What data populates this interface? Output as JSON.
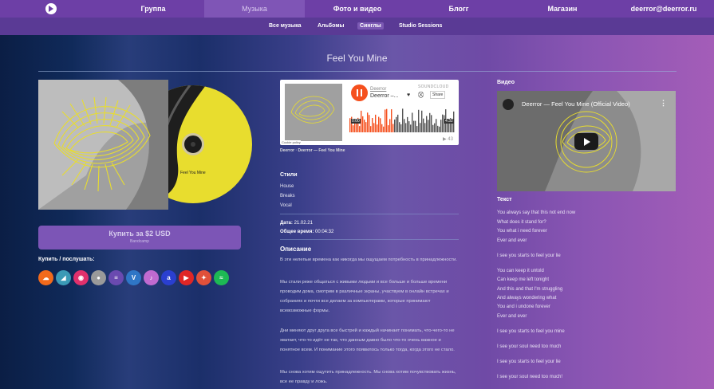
{
  "nav": {
    "items": [
      {
        "label": "Группа"
      },
      {
        "label": "Музыка"
      },
      {
        "label": "Фото и видео"
      },
      {
        "label": "Блогг"
      },
      {
        "label": "Магазин"
      },
      {
        "label": "deerror@deerror.ru"
      }
    ],
    "active": "Музыка"
  },
  "subnav": {
    "items": [
      {
        "label": "Все музыка"
      },
      {
        "label": "Альбомы"
      },
      {
        "label": "Синглы"
      },
      {
        "label": "Studio Sessions"
      }
    ],
    "active": "Синглы"
  },
  "page": {
    "title": "Feel You Mine"
  },
  "cd": {
    "text": "Feel You Mine"
  },
  "buy": {
    "button_label": "Купить за $2 USD",
    "button_sub": "Bandcamp",
    "title": "Купить / послушать:",
    "services": [
      {
        "icon": "soundcloud-icon",
        "color": "#f26a1b"
      },
      {
        "icon": "bandcamp-icon",
        "color": "#3b9ab6"
      },
      {
        "icon": "podcast-icon",
        "color": "#e1306c"
      },
      {
        "icon": "apple-icon",
        "color": "#9a9a9a"
      },
      {
        "icon": "deezer-icon",
        "color": "#6a4ab0"
      },
      {
        "icon": "vk-icon",
        "color": "#2f76c6"
      },
      {
        "icon": "itunes-icon",
        "color": "#c06ad0"
      },
      {
        "icon": "amazon-music-icon",
        "color": "#2a3fd0"
      },
      {
        "icon": "youtube-icon",
        "color": "#e02626"
      },
      {
        "icon": "gift-icon",
        "color": "#e0503a"
      },
      {
        "icon": "spotify-icon",
        "color": "#1db954"
      }
    ]
  },
  "soundcloud": {
    "artist": "Deerror",
    "track": "Deerror –...",
    "brand": "SOUNDCLOUD",
    "share_label": "Share",
    "time_start": "0:00",
    "time_end": "4:32",
    "plays": "43",
    "cookie": "Cookie policy",
    "caption": "Deerror · Deerror — Feel You Mine"
  },
  "styles": {
    "heading": "Стили",
    "items": [
      "House",
      "Breaks",
      "Vocal"
    ]
  },
  "meta": {
    "date_label": "Дата:",
    "date_value": "21.02.21",
    "time_label": "Общее время:",
    "time_value": "00:04:32"
  },
  "description": {
    "heading": "Описание",
    "paragraphs": [
      "В эти нелепые времена как никогда мы ощущаем потребность в принадлежности.",
      "Мы стали реже общаться с живыми людьми и все больше и больше времени проводим дома, смотрим в различные экраны, участвуем в онлайн встречах и собраниях и почти все делаем за компьютерами, которые принимают всевозможные формы.",
      "Дни меняют друг друга все быстрей и каждый начинает понимать, что-чего-то не хватает, что-то идёт не так, что данным давно было что-то очень важное и понятное всем. И понимание этого появилось только тогда, когда этого не стало.",
      "Мы снова хотим ощутить принадлежность. Мы снова хотим почувствовать жизнь, все ее правду и ложь."
    ]
  },
  "video": {
    "heading": "Видео",
    "title": "Deerror — Feel You Mine (Official Video)"
  },
  "lyrics": {
    "heading": "Текст",
    "lines": [
      "You always say that this not end now",
      "What does it stand for?",
      "You what i need forever",
      "Ever and ever",
      "I see you starts to feel your lie",
      "You can keep it untold",
      "Can keep me left tonight",
      "And this and that I'm struggling",
      "And always wondering what",
      "You and i undone forever",
      "Ever and ever",
      "I see you starts to feel you mine",
      "I see your soul need too much",
      "I see you starts to feel your lie",
      "I see your soul need too much!"
    ]
  }
}
